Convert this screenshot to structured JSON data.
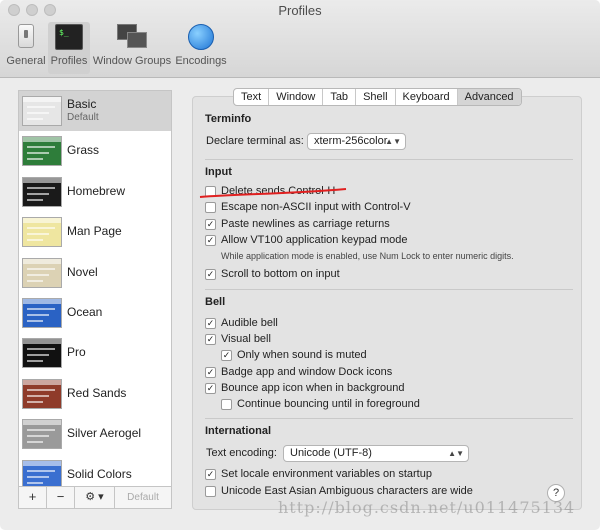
{
  "window": {
    "title": "Profiles"
  },
  "toolbar": {
    "items": [
      {
        "label": "General",
        "icon": "general-switch-icon"
      },
      {
        "label": "Profiles",
        "icon": "terminal-icon",
        "selected": true
      },
      {
        "label": "Window Groups",
        "icon": "window-groups-icon"
      },
      {
        "label": "Encodings",
        "icon": "globe-icon"
      }
    ]
  },
  "sidebar": {
    "profiles": [
      {
        "name": "Basic",
        "sub": "Default",
        "color": "#e6e6e6",
        "selected": true
      },
      {
        "name": "Grass",
        "color": "#2e7d3a"
      },
      {
        "name": "Homebrew",
        "color": "#1a1a1a"
      },
      {
        "name": "Man Page",
        "color": "#efe6a0"
      },
      {
        "name": "Novel",
        "color": "#dcd2b4"
      },
      {
        "name": "Ocean",
        "color": "#2a62c4"
      },
      {
        "name": "Pro",
        "color": "#111111"
      },
      {
        "name": "Red Sands",
        "color": "#8f3b2a"
      },
      {
        "name": "Silver Aerogel",
        "color": "#9a9a9a"
      },
      {
        "name": "Solid Colors",
        "color": "#3a6fd0"
      }
    ],
    "add_label": "+",
    "remove_label": "−",
    "gear_label": "⚙ ▾",
    "default_label": "Default"
  },
  "tabs": [
    "Text",
    "Window",
    "Tab",
    "Shell",
    "Keyboard",
    "Advanced"
  ],
  "terminfo": {
    "heading": "Terminfo",
    "declare_label": "Declare terminal as:",
    "declare_value": "xterm-256color"
  },
  "input": {
    "heading": "Input",
    "options": [
      {
        "label": "Delete sends Control-H",
        "checked": false
      },
      {
        "label": "Escape non-ASCII input with Control-V",
        "checked": false
      },
      {
        "label": "Paste newlines as carriage returns",
        "checked": true
      },
      {
        "label": "Allow VT100 application keypad mode",
        "checked": true
      }
    ],
    "note": "While application mode is enabled, use Num Lock to enter numeric digits.",
    "scroll": {
      "label": "Scroll to bottom on input",
      "checked": true
    }
  },
  "bell": {
    "heading": "Bell",
    "options": [
      {
        "label": "Audible bell",
        "checked": true
      },
      {
        "label": "Visual bell",
        "checked": true
      },
      {
        "label": "Only when sound is muted",
        "checked": true
      },
      {
        "label": "Badge app and window Dock icons",
        "checked": true
      },
      {
        "label": "Bounce app icon when in background",
        "checked": true
      },
      {
        "label": "Continue bouncing until in foreground",
        "checked": false
      }
    ]
  },
  "international": {
    "heading": "International",
    "encoding_label": "Text encoding:",
    "encoding_value": "Unicode (UTF-8)",
    "options": [
      {
        "label": "Set locale environment variables on startup",
        "checked": true
      },
      {
        "label": "Unicode East Asian Ambiguous characters are wide",
        "checked": false
      }
    ]
  },
  "help_label": "?",
  "watermark": "http://blog.csdn.net/u011475134"
}
